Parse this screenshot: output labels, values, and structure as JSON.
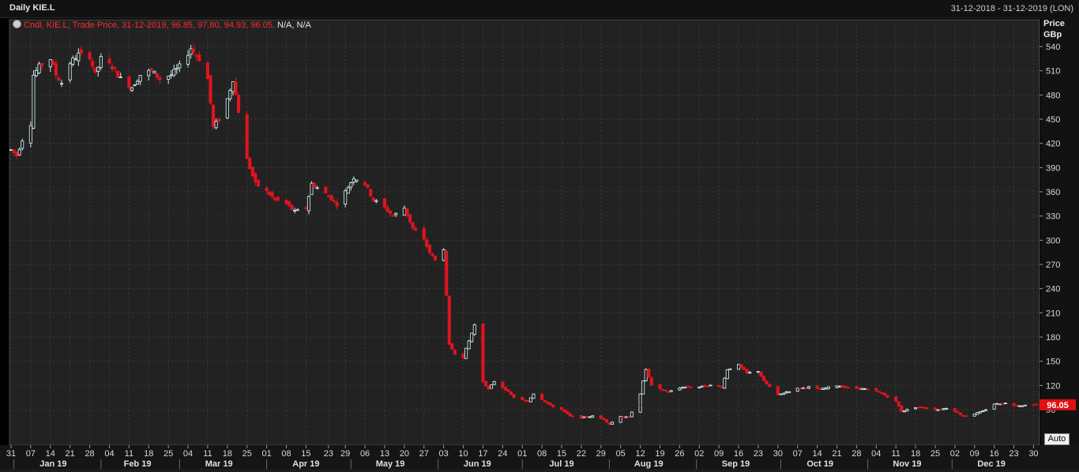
{
  "window": {
    "title": "Daily KIE.L",
    "date_range": "31-12-2018 - 31-12-2019 (LON)"
  },
  "legend": {
    "text": "Cndl, KIE.L, Trade Price,  31-12-2019, 96.85, 97.80, 94.93, 96.05,",
    "na": " N/A, N/A"
  },
  "axis": {
    "unit_line1": "Price",
    "unit_line2": "GBp",
    "last_price": "96.05",
    "auto_label": "Auto"
  },
  "colors": {
    "background": "#000000",
    "plot_background": "#222222",
    "grid": "#3a3a3a",
    "up": "#cfe8ea",
    "down": "#e0141e",
    "last_price_box": "#e01010"
  },
  "chart_data": {
    "type": "candlestick",
    "title": "Daily KIE.L",
    "ylabel": "Price GBp",
    "ylim": [
      60,
      555
    ],
    "y_ticks": [
      90,
      120,
      150,
      180,
      210,
      240,
      270,
      300,
      330,
      360,
      390,
      420,
      450,
      480,
      510,
      540
    ],
    "x_range": [
      "2018-12-31",
      "2019-12-31"
    ],
    "x_tick_labels": [
      [
        "2018-12-31",
        "31"
      ],
      [
        "2019-01-07",
        "07"
      ],
      [
        "2019-01-14",
        "14"
      ],
      [
        "2019-01-21",
        "21"
      ],
      [
        "2019-01-28",
        "28"
      ],
      [
        "2019-02-04",
        "04"
      ],
      [
        "2019-02-11",
        "11"
      ],
      [
        "2019-02-18",
        "18"
      ],
      [
        "2019-02-25",
        "25"
      ],
      [
        "2019-03-04",
        "04"
      ],
      [
        "2019-03-11",
        "11"
      ],
      [
        "2019-03-18",
        "18"
      ],
      [
        "2019-03-25",
        "25"
      ],
      [
        "2019-04-01",
        "01"
      ],
      [
        "2019-04-08",
        "08"
      ],
      [
        "2019-04-15",
        "15"
      ],
      [
        "2019-04-23",
        "23"
      ],
      [
        "2019-04-29",
        "29"
      ],
      [
        "2019-05-06",
        "06"
      ],
      [
        "2019-05-13",
        "13"
      ],
      [
        "2019-05-20",
        "20"
      ],
      [
        "2019-05-27",
        "27"
      ],
      [
        "2019-06-03",
        "03"
      ],
      [
        "2019-06-10",
        "10"
      ],
      [
        "2019-06-17",
        "17"
      ],
      [
        "2019-06-24",
        "24"
      ],
      [
        "2019-07-01",
        "01"
      ],
      [
        "2019-07-08",
        "08"
      ],
      [
        "2019-07-15",
        "15"
      ],
      [
        "2019-07-22",
        "22"
      ],
      [
        "2019-07-29",
        "29"
      ],
      [
        "2019-08-05",
        "05"
      ],
      [
        "2019-08-12",
        "12"
      ],
      [
        "2019-08-19",
        "19"
      ],
      [
        "2019-08-26",
        "26"
      ],
      [
        "2019-09-02",
        "02"
      ],
      [
        "2019-09-09",
        "09"
      ],
      [
        "2019-09-16",
        "16"
      ],
      [
        "2019-09-23",
        "23"
      ],
      [
        "2019-09-30",
        "30"
      ],
      [
        "2019-10-07",
        "07"
      ],
      [
        "2019-10-14",
        "14"
      ],
      [
        "2019-10-21",
        "21"
      ],
      [
        "2019-10-28",
        "28"
      ],
      [
        "2019-11-04",
        "04"
      ],
      [
        "2019-11-11",
        "11"
      ],
      [
        "2019-11-18",
        "18"
      ],
      [
        "2019-11-25",
        "25"
      ],
      [
        "2019-12-02",
        "02"
      ],
      [
        "2019-12-09",
        "09"
      ],
      [
        "2019-12-16",
        "16"
      ],
      [
        "2019-12-23",
        "23"
      ],
      [
        "2019-12-30",
        "30"
      ]
    ],
    "month_labels": [
      [
        "2019-01-15",
        "Jan 19"
      ],
      [
        "2019-02-14",
        "Feb 19"
      ],
      [
        "2019-03-15",
        "Mar 19"
      ],
      [
        "2019-04-15",
        "Apr 19"
      ],
      [
        "2019-05-15",
        "May 19"
      ],
      [
        "2019-06-15",
        "Jun 19"
      ],
      [
        "2019-07-15",
        "Jul 19"
      ],
      [
        "2019-08-15",
        "Aug 19"
      ],
      [
        "2019-09-15",
        "Sep 19"
      ],
      [
        "2019-10-15",
        "Oct 19"
      ],
      [
        "2019-11-15",
        "Nov 19"
      ],
      [
        "2019-12-15",
        "Dec 19"
      ]
    ],
    "month_separators": [
      "2019-01-01",
      "2019-02-01",
      "2019-03-01",
      "2019-04-01",
      "2019-05-01",
      "2019-06-01",
      "2019-07-01",
      "2019-08-01",
      "2019-09-01",
      "2019-10-01",
      "2019-11-01",
      "2019-12-01"
    ],
    "last_close": 96.05,
    "close_anchors": [
      [
        "2018-12-31",
        412
      ],
      [
        "2019-01-02",
        405
      ],
      [
        "2019-01-04",
        425
      ],
      [
        "2019-01-07",
        445
      ],
      [
        "2019-01-08",
        505
      ],
      [
        "2019-01-10",
        515
      ],
      [
        "2019-01-14",
        525
      ],
      [
        "2019-01-16",
        505
      ],
      [
        "2019-01-18",
        495
      ],
      [
        "2019-01-21",
        520
      ],
      [
        "2019-01-24",
        530
      ],
      [
        "2019-01-28",
        528
      ],
      [
        "2019-01-30",
        505
      ],
      [
        "2019-02-01",
        525
      ],
      [
        "2019-02-05",
        515
      ],
      [
        "2019-02-08",
        500
      ],
      [
        "2019-02-12",
        490
      ],
      [
        "2019-02-15",
        505
      ],
      [
        "2019-02-19",
        510
      ],
      [
        "2019-02-22",
        500
      ],
      [
        "2019-02-26",
        505
      ],
      [
        "2019-03-01",
        515
      ],
      [
        "2019-03-05",
        538
      ],
      [
        "2019-03-08",
        525
      ],
      [
        "2019-03-11",
        500
      ],
      [
        "2019-03-13",
        440
      ],
      [
        "2019-03-15",
        450
      ],
      [
        "2019-03-18",
        475
      ],
      [
        "2019-03-20",
        500
      ],
      [
        "2019-03-22",
        460
      ],
      [
        "2019-03-25",
        400
      ],
      [
        "2019-03-28",
        370
      ],
      [
        "2019-04-01",
        360
      ],
      [
        "2019-04-04",
        350
      ],
      [
        "2019-04-08",
        345
      ],
      [
        "2019-04-11",
        335
      ],
      [
        "2019-04-15",
        340
      ],
      [
        "2019-04-17",
        370
      ],
      [
        "2019-04-23",
        355
      ],
      [
        "2019-04-26",
        345
      ],
      [
        "2019-04-29",
        360
      ],
      [
        "2019-05-02",
        378
      ],
      [
        "2019-05-06",
        370
      ],
      [
        "2019-05-09",
        350
      ],
      [
        "2019-05-13",
        340
      ],
      [
        "2019-05-16",
        330
      ],
      [
        "2019-05-20",
        340
      ],
      [
        "2019-05-23",
        315
      ],
      [
        "2019-05-27",
        300
      ],
      [
        "2019-05-29",
        285
      ],
      [
        "2019-05-31",
        275
      ],
      [
        "2019-06-03",
        290
      ],
      [
        "2019-06-05",
        170
      ],
      [
        "2019-06-07",
        160
      ],
      [
        "2019-06-10",
        155
      ],
      [
        "2019-06-12",
        175
      ],
      [
        "2019-06-14",
        195
      ],
      [
        "2019-06-17",
        125
      ],
      [
        "2019-06-19",
        115
      ],
      [
        "2019-06-21",
        125
      ],
      [
        "2019-06-25",
        115
      ],
      [
        "2019-06-28",
        105
      ],
      [
        "2019-07-03",
        100
      ],
      [
        "2019-07-05",
        110
      ],
      [
        "2019-07-08",
        103
      ],
      [
        "2019-07-11",
        95
      ],
      [
        "2019-07-15",
        90
      ],
      [
        "2019-07-18",
        82
      ],
      [
        "2019-07-22",
        80
      ],
      [
        "2019-07-26",
        82
      ],
      [
        "2019-07-30",
        78
      ],
      [
        "2019-08-01",
        72
      ],
      [
        "2019-08-05",
        82
      ],
      [
        "2019-08-08",
        80
      ],
      [
        "2019-08-12",
        110
      ],
      [
        "2019-08-14",
        140
      ],
      [
        "2019-08-16",
        120
      ],
      [
        "2019-08-19",
        115
      ],
      [
        "2019-08-22",
        112
      ],
      [
        "2019-08-27",
        118
      ],
      [
        "2019-09-02",
        118
      ],
      [
        "2019-09-06",
        120
      ],
      [
        "2019-09-10",
        118
      ],
      [
        "2019-09-12",
        140
      ],
      [
        "2019-09-16",
        145
      ],
      [
        "2019-09-19",
        135
      ],
      [
        "2019-09-23",
        138
      ],
      [
        "2019-09-25",
        125
      ],
      [
        "2019-09-30",
        108
      ],
      [
        "2019-10-03",
        112
      ],
      [
        "2019-10-07",
        116
      ],
      [
        "2019-10-11",
        118
      ],
      [
        "2019-10-15",
        115
      ],
      [
        "2019-10-21",
        120
      ],
      [
        "2019-10-25",
        117
      ],
      [
        "2019-10-30",
        116
      ],
      [
        "2019-11-04",
        113
      ],
      [
        "2019-11-07",
        108
      ],
      [
        "2019-11-11",
        100
      ],
      [
        "2019-11-13",
        88
      ],
      [
        "2019-11-18",
        93
      ],
      [
        "2019-11-22",
        92
      ],
      [
        "2019-11-26",
        90
      ],
      [
        "2019-11-29",
        92
      ],
      [
        "2019-12-02",
        88
      ],
      [
        "2019-12-05",
        82
      ],
      [
        "2019-12-09",
        85
      ],
      [
        "2019-12-12",
        88
      ],
      [
        "2019-12-16",
        97
      ],
      [
        "2019-12-20",
        98
      ],
      [
        "2019-12-24",
        95
      ],
      [
        "2019-12-31",
        96.05
      ]
    ]
  }
}
